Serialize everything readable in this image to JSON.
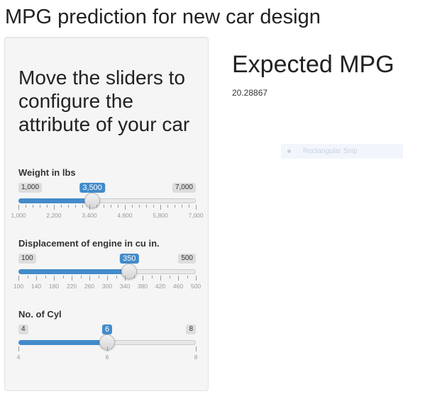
{
  "page": {
    "title": "MPG prediction for new car design"
  },
  "sidebar": {
    "heading": "Move the sliders to configure the attribute of your car",
    "sliders": [
      {
        "id": "weight",
        "label": "Weight in lbs",
        "min": 1000,
        "max": 7000,
        "value": 3500,
        "min_label": "1,000",
        "max_label": "7,000",
        "value_label": "3,500",
        "tick_labels": [
          "1,000",
          "2,200",
          "3,400",
          "4,600",
          "5,800",
          "7,000"
        ],
        "minor_per_major": 4
      },
      {
        "id": "displacement",
        "label": "Displacement of engine in cu in.",
        "min": 100,
        "max": 500,
        "value": 350,
        "min_label": "100",
        "max_label": "500",
        "value_label": "350",
        "tick_labels": [
          "100",
          "140",
          "180",
          "220",
          "260",
          "300",
          "340",
          "380",
          "420",
          "460",
          "500"
        ],
        "minor_per_major": 1
      },
      {
        "id": "cylinders",
        "label": "No. of Cyl",
        "min": 4,
        "max": 8,
        "value": 6,
        "min_label": "4",
        "max_label": "8",
        "value_label": "6",
        "tick_labels": [
          "4",
          "6",
          "8"
        ],
        "minor_per_major": 0
      }
    ]
  },
  "main": {
    "heading": "Expected MPG",
    "value": "20.28867"
  },
  "overlay": {
    "label": "Rectangular Snip",
    "icon": "record-dot-icon"
  },
  "colors": {
    "accent": "#428bca",
    "panel": "#f5f5f5",
    "badge": "#dddddd"
  }
}
